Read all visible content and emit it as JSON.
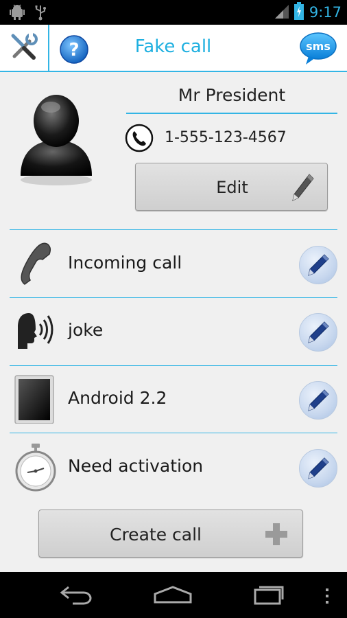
{
  "status_bar": {
    "time": "9:17",
    "icons": [
      "android-debug-icon",
      "usb-icon",
      "signal-icon",
      "battery-charging-icon"
    ]
  },
  "action_bar": {
    "title": "Fake call",
    "tools_icon": "tools-icon",
    "help_icon": "help-icon",
    "sms_icon": "sms-icon",
    "sms_label": "sms"
  },
  "contact": {
    "name": "Mr President",
    "phone": "1-555-123-4567",
    "edit_label": "Edit"
  },
  "calls": [
    {
      "label": "Incoming call",
      "icon": "handset-icon"
    },
    {
      "label": "joke",
      "icon": "speaking-head-icon"
    },
    {
      "label": "Android 2.2",
      "icon": "tablet-icon"
    },
    {
      "label": "Need activation",
      "icon": "stopwatch-icon"
    }
  ],
  "create_label": "Create call",
  "colors": {
    "accent": "#33b5e5",
    "title": "#1fb0e0",
    "background": "#f0f0f0"
  }
}
